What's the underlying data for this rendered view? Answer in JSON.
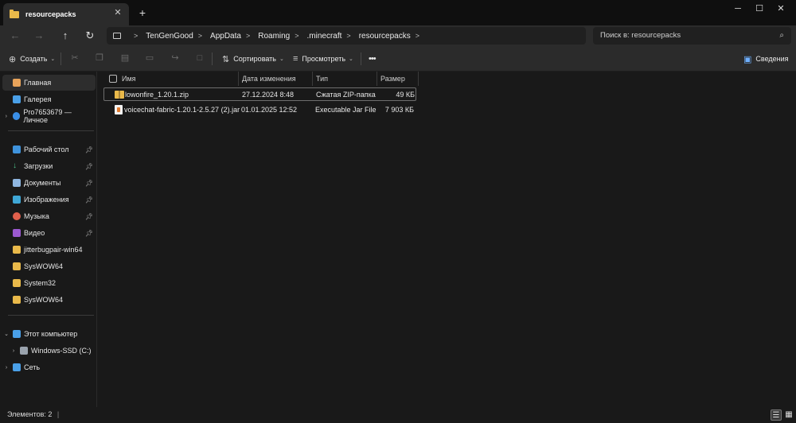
{
  "window": {
    "tab_title": "resourcepacks",
    "new_tab_label": "+",
    "minimize_label": "─",
    "maximize_label": "☐",
    "close_label": "✕",
    "tab_close_label": "✕"
  },
  "address": {
    "back": "←",
    "forward": "→",
    "up": "↑",
    "refresh": "↻",
    "breadcrumbs": [
      "TenGenGood",
      "AppData",
      "Roaming",
      ".minecraft",
      "resourcepacks"
    ],
    "separator": ">",
    "search_placeholder": "Поиск в: resourcepacks"
  },
  "toolbar": {
    "create_label": "Создать",
    "sort_label": "Сортировать",
    "view_label": "Просмотреть",
    "more_label": "•••",
    "details_label": "Сведения"
  },
  "sidebar": {
    "items": [
      {
        "label": "Главная",
        "icon": "home-icon",
        "active": true
      },
      {
        "label": "Галерея",
        "icon": "gallery-icon"
      },
      {
        "label": "Pro7653679 — Личное",
        "icon": "onedrive-icon",
        "expandable": true
      },
      {
        "label": "Рабочий стол",
        "icon": "desktop-icon",
        "pinned": true
      },
      {
        "label": "Загрузки",
        "icon": "downloads-icon",
        "pinned": true
      },
      {
        "label": "Документы",
        "icon": "documents-icon",
        "pinned": true
      },
      {
        "label": "Изображения",
        "icon": "pictures-icon",
        "pinned": true
      },
      {
        "label": "Музыка",
        "icon": "music-icon",
        "pinned": true
      },
      {
        "label": "Видео",
        "icon": "videos-icon",
        "pinned": true
      },
      {
        "label": "jitterbugpair-win64",
        "icon": "folder-icon"
      },
      {
        "label": "SysWOW64",
        "icon": "folder-icon"
      },
      {
        "label": "System32",
        "icon": "folder-icon"
      },
      {
        "label": "SysWOW64",
        "icon": "folder-icon"
      },
      {
        "label": "Этот компьютер",
        "icon": "this-pc-icon",
        "expanded": true
      },
      {
        "label": "Windows-SSD (C:)",
        "icon": "drive-icon",
        "expandable": true
      },
      {
        "label": "Сеть",
        "icon": "network-icon",
        "expandable": true
      }
    ]
  },
  "filelist": {
    "columns": [
      "Имя",
      "Дата изменения",
      "Тип",
      "Размер"
    ],
    "rows": [
      {
        "name": "lowonfire_1.20.1.zip",
        "date": "27.12.2024 8:48",
        "type": "Сжатая ZIP-папка",
        "size": "49 КБ",
        "icon": "zip-folder-icon",
        "selected": true
      },
      {
        "name": "voicechat-fabric-1.20.1-2.5.27 (2).jar",
        "date": "01.01.2025 12:52",
        "type": "Executable Jar File",
        "size": "7 903 КБ",
        "icon": "jar-file-icon"
      }
    ]
  },
  "status": {
    "items_text": "Элементов: 2",
    "separator": "|"
  },
  "colors": {
    "folder": "#e9b94a",
    "background": "#191919",
    "chrome": "#2b2b2b",
    "titlebar": "#0f0f0f"
  }
}
